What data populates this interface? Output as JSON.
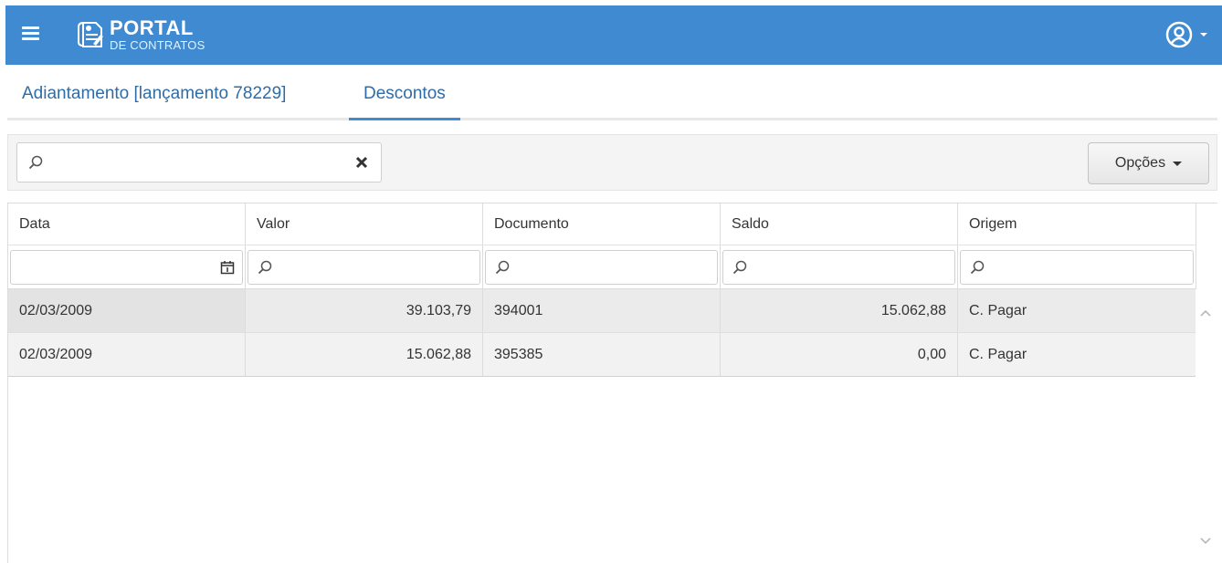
{
  "header": {
    "logo_main": "PORTAL",
    "logo_sub": "DE CONTRATOS",
    "menu_icon": "hamburger-icon",
    "user_icon": "user-circle-icon"
  },
  "tabs": [
    {
      "label": "Adiantamento [lançamento 78229]",
      "active": false
    },
    {
      "label": "Descontos",
      "active": true
    }
  ],
  "toolbar": {
    "search_value": "",
    "search_placeholder": "",
    "options_label": "Opções"
  },
  "grid": {
    "columns": [
      "Data",
      "Valor",
      "Documento",
      "Saldo",
      "Origem"
    ],
    "rows": [
      {
        "data": "02/03/2009",
        "valor": "39.103,79",
        "documento": "394001",
        "saldo": "15.062,88",
        "origem": "C. Pagar"
      },
      {
        "data": "02/03/2009",
        "valor": "15.062,88",
        "documento": "395385",
        "saldo": "0,00",
        "origem": "C. Pagar"
      }
    ]
  },
  "colors": {
    "header_bg": "#3f8ad0",
    "tab_text": "#2e6ca8",
    "active_underline": "#3f8ad0"
  }
}
